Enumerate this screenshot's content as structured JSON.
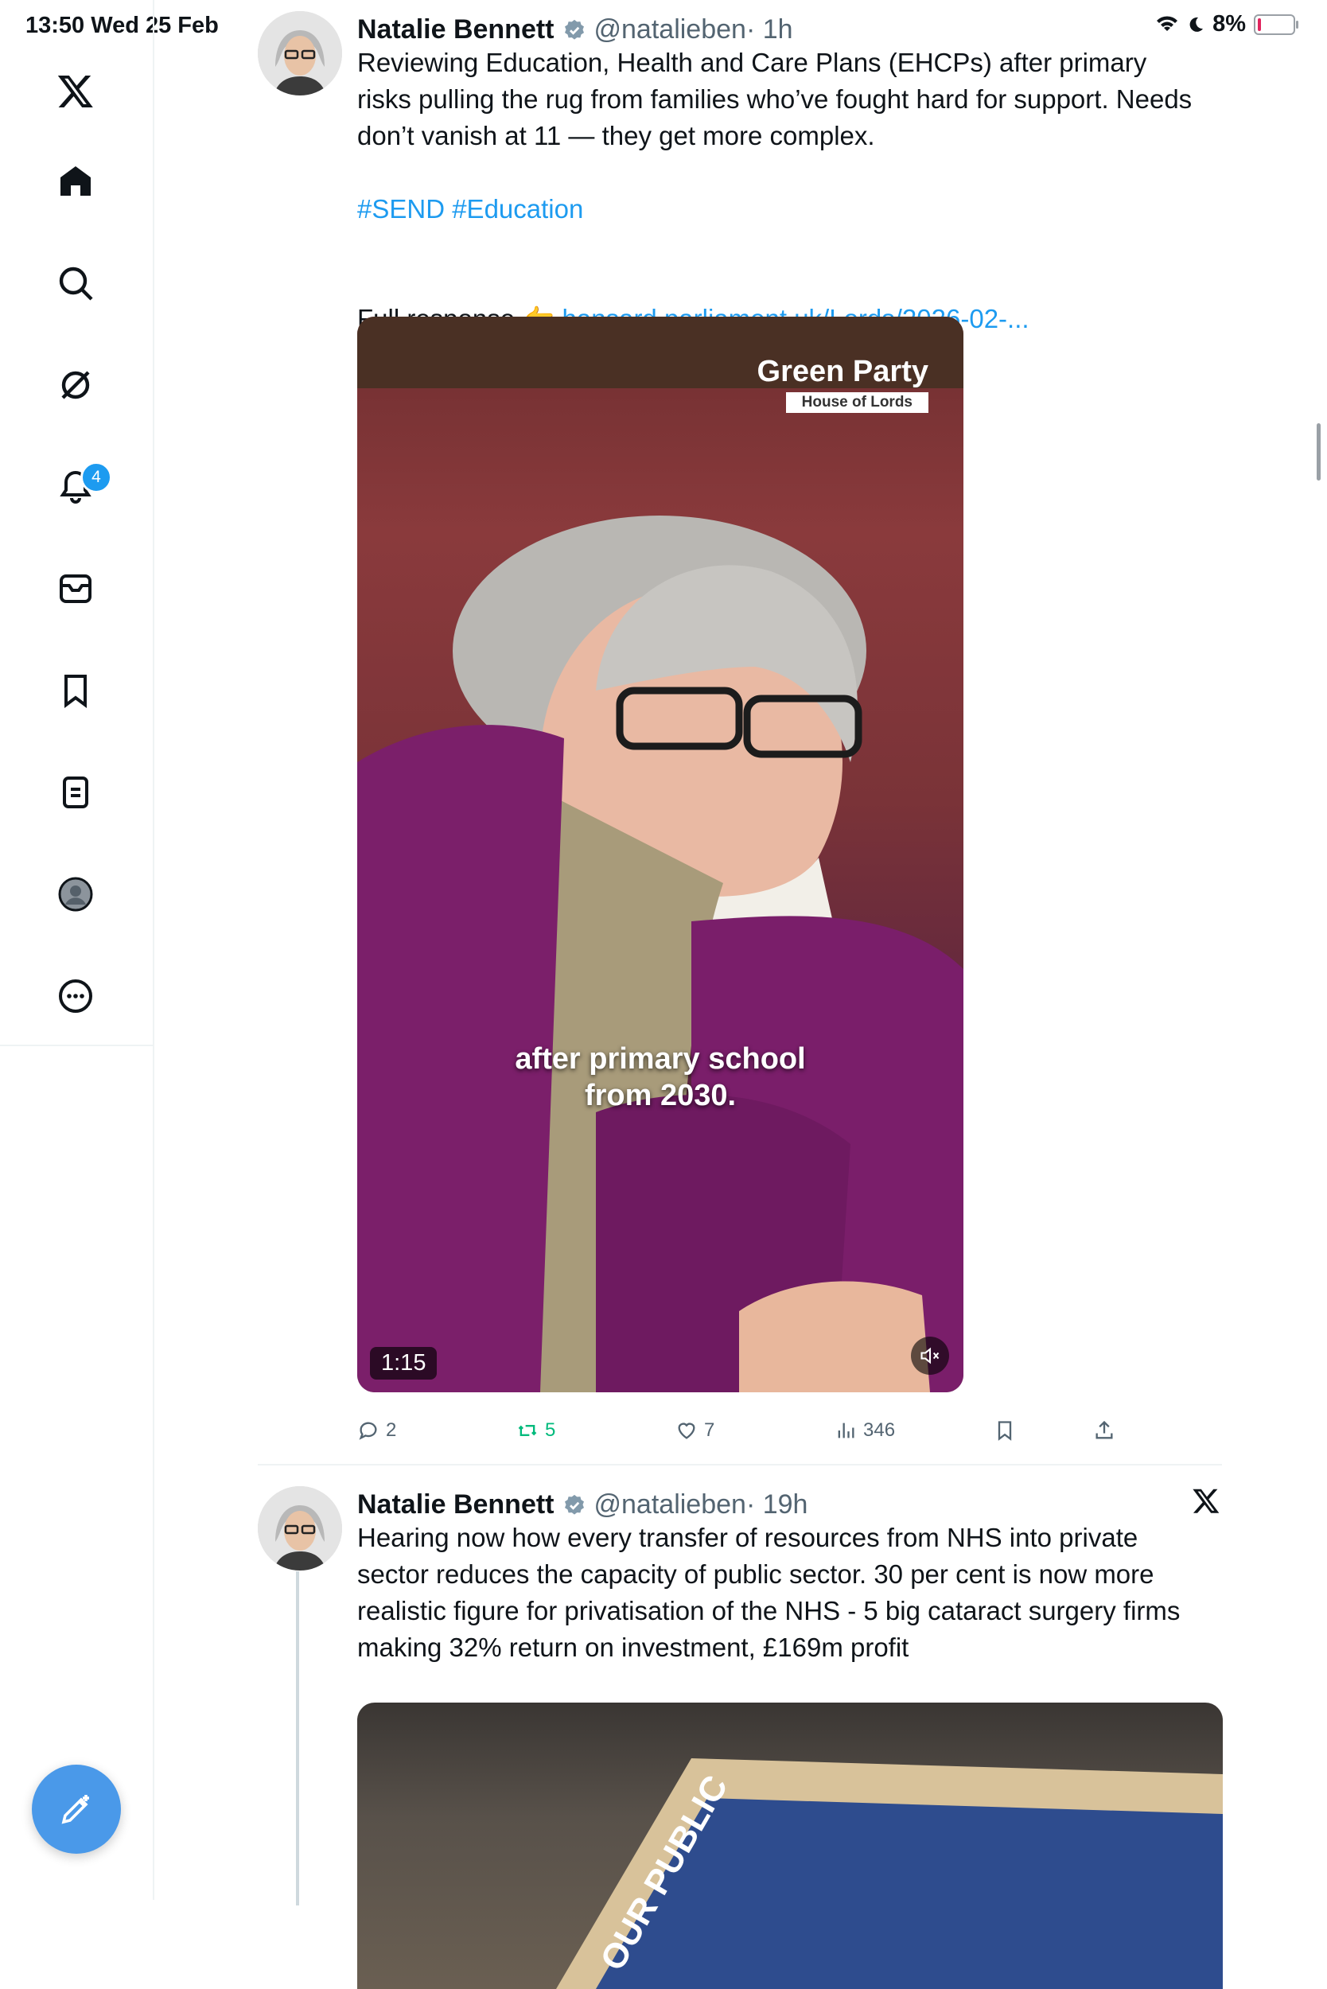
{
  "status_bar": {
    "time_date": "13:50   Wed 25 Feb",
    "battery": "8%",
    "battery_level": 0.08
  },
  "sidebar": {
    "items": [
      {
        "name": "x-logo-icon"
      },
      {
        "name": "home-icon"
      },
      {
        "name": "search-icon"
      },
      {
        "name": "grok-icon"
      },
      {
        "name": "notifications-icon",
        "badge": "4"
      },
      {
        "name": "messages-icon"
      },
      {
        "name": "bookmarks-icon"
      },
      {
        "name": "lists-icon"
      },
      {
        "name": "profile-icon"
      },
      {
        "name": "more-icon"
      }
    ],
    "compose_icon": "compose-icon"
  },
  "tweets": [
    {
      "name": "Natalie Bennett",
      "handle": "@natalieben",
      "time": " · 1h",
      "text": "Reviewing Education, Health and Care Plans (EHCPs) after primary risks pulling the rug from families who’ve fought hard for support. Needs don’t vanish at 11 — they get more complex.",
      "hashtags": "#SEND #Education",
      "link_prefix": "Full response 👉 ",
      "link": "hansard.parliament.uk/Lords/2026-02-...",
      "video": {
        "logo_title": "Green Party",
        "logo_subtitle": "House of Lords",
        "caption_line1": "after primary school",
        "caption_line2": "from 2030.",
        "duration": "1:15"
      },
      "stats": {
        "replies": "2",
        "reposts": "5",
        "likes": "7",
        "views": "346"
      }
    },
    {
      "name": "Natalie Bennett",
      "handle": "@natalieben",
      "time": " · 19h",
      "text": "Hearing now how every transfer of resources from NHS into private sector reduces the capacity of public sector. 30 per cent is now more realistic figure for privatisation of the NHS - 5 big cataract surgery firms making 32% return on investment, £169m profit",
      "image_text": "OUR PUBLIC"
    }
  ],
  "colors": {
    "accent": "#1d9bf0",
    "repost_green": "#00ba7c",
    "compose_bg": "#4a99e9"
  }
}
